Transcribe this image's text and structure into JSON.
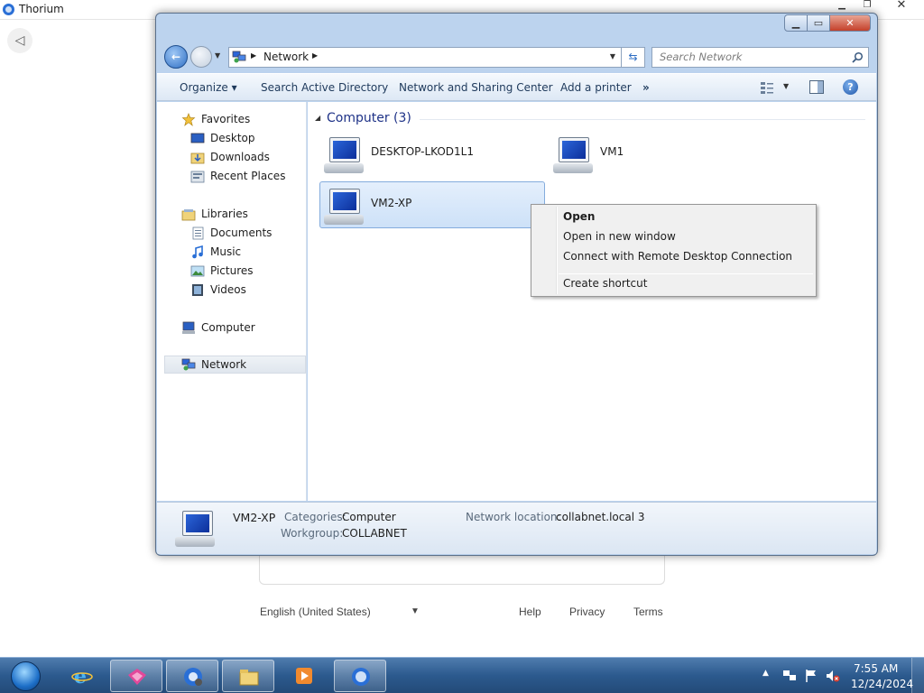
{
  "browser": {
    "title": "Thorium",
    "footer": {
      "language": "English (United States)",
      "help": "Help",
      "privacy": "Privacy",
      "terms": "Terms"
    }
  },
  "explorer": {
    "address": {
      "location": "Network",
      "search_placeholder": "Search Network"
    },
    "toolbar": {
      "organize": "Organize",
      "search_ad": "Search Active Directory",
      "network_sharing": "Network and Sharing Center",
      "add_printer": "Add a printer",
      "more": "»"
    },
    "nav": {
      "favorites": "Favorites",
      "desktop": "Desktop",
      "downloads": "Downloads",
      "recent_places": "Recent Places",
      "libraries": "Libraries",
      "documents": "Documents",
      "music": "Music",
      "pictures": "Pictures",
      "videos": "Videos",
      "computer": "Computer",
      "network": "Network"
    },
    "group": {
      "label": "Computer (3)"
    },
    "items": [
      {
        "name": "DESKTOP-LKOD1L1"
      },
      {
        "name": "VM1"
      },
      {
        "name": "VM2-XP"
      }
    ],
    "details": {
      "name": "VM2-XP",
      "categories_key": "Categories:",
      "categories_value": "Computer",
      "workgroup_key": "Workgroup:",
      "workgroup_value": "COLLABNET",
      "location_key": "Network location:",
      "location_value": "collabnet.local 3"
    },
    "context_menu": [
      {
        "label": "Open"
      },
      {
        "label": "Open in new window"
      },
      {
        "label": "Connect with Remote Desktop Connection"
      },
      {
        "label": "Create shortcut"
      }
    ]
  },
  "taskbar": {
    "time": "7:55 AM",
    "date": "12/24/2024"
  },
  "icons": {
    "start": "windows-start-orb",
    "ie": "internet-explorer-icon",
    "app1": "app-pink-icon",
    "chrome_user": "chrome-user-icon",
    "explorer": "folder-icon",
    "media": "media-player-icon",
    "thorium": "thorium-icon"
  },
  "colors": {
    "accent": "#1e3287",
    "selection": "#cde1f8",
    "taskbar": "#2c5a8e"
  }
}
